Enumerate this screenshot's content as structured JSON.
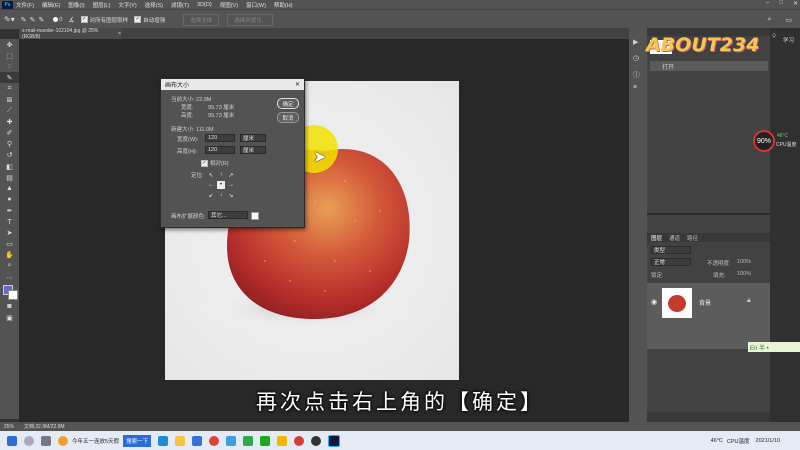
{
  "menu": {
    "items": [
      "文件(F)",
      "编辑(E)",
      "图像(I)",
      "图层(L)",
      "文字(Y)",
      "选择(S)",
      "滤镜(T)",
      "3D(D)",
      "视图(V)",
      "窗口(W)",
      "帮助(H)"
    ]
  },
  "options": {
    "size": "0",
    "all_layers": "对所有图层取样",
    "auto_enhance": "自动增强",
    "select_subject": "选择主体",
    "select_and_mask": "选择并遮住..."
  },
  "tab": {
    "label": "s-mail-maeder-102104.jpg @ 25%(RGB/8)",
    "close": "×"
  },
  "dialog": {
    "title": "画布大小",
    "current_size": "当前大小: 22.9M",
    "cur_width_label": "宽度:",
    "cur_width_value": "99.73 厘米",
    "cur_height_label": "高度:",
    "cur_height_value": "99.73 厘米",
    "new_size": "新建大小: 111.0M",
    "width_label": "宽度(W):",
    "width_value": "120",
    "width_unit": "厘米",
    "height_label": "高度(H):",
    "height_value": "120",
    "height_unit": "厘米",
    "relative": "相对(R)",
    "anchor_label": "定位:",
    "ext_color_label": "画布扩展颜色:",
    "ext_color_value": "其它...",
    "ok": "确定",
    "cancel": "取消",
    "anchors": [
      "↖",
      "↑",
      "↗",
      "←",
      "•",
      "→",
      "↙",
      "↓",
      "↘"
    ]
  },
  "right_panel": {
    "history_item": "打开",
    "tabs": [
      "图层",
      "通道",
      "路径"
    ],
    "kind_label": "类型",
    "blend_mode": "正常",
    "opacity_label": "不透明度:",
    "opacity_value": "100%",
    "lock_label": "锁定:",
    "fill_label": "填充:",
    "fill_value": "100%",
    "layer_name": "背景"
  },
  "widgets": {
    "logo": "ABOUT234",
    "study": "学习",
    "temp_value": "90%",
    "cpu_temp": "46°C",
    "cpu_label": "CPU温度",
    "ime": "En 半 •"
  },
  "status": {
    "zoom": "25%",
    "doc": "文档:22.9M/22.9M"
  },
  "taskbar": {
    "news": "今年五一连放5天假",
    "search_btn": "搜索一下",
    "temp": "46°C",
    "cpu": "CPU温度",
    "date": "2021/1/10"
  },
  "subtitle": "再次点击右上角的【确定】",
  "colors": {
    "accent_yellow": "#f2e200",
    "apple_red": "#c63a2d"
  }
}
